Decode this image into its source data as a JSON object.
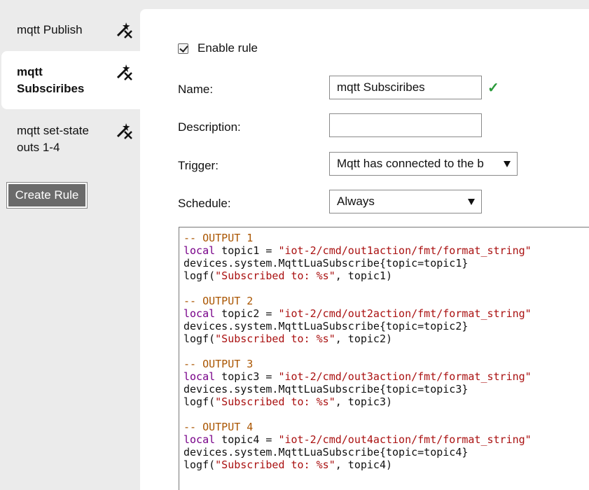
{
  "sidebar": {
    "rules": [
      {
        "label": "mqtt Publish",
        "icon": "wand-delete-icon"
      },
      {
        "label": "mqtt Subsciribes",
        "icon": "wand-delete-icon",
        "active": true
      },
      {
        "label": "mqtt set-state outs 1-4",
        "icon": "wand-delete-icon"
      }
    ],
    "create_button": "Create Rule"
  },
  "form": {
    "enable_label": "Enable rule",
    "enabled": true,
    "name_label": "Name:",
    "name_value": "mqtt Subsciribes",
    "name_valid_mark": "✓",
    "description_label": "Description:",
    "description_value": "",
    "trigger_label": "Trigger:",
    "trigger_value": "Mqtt has connected to the b",
    "schedule_label": "Schedule:",
    "schedule_value": "Always"
  },
  "code_blocks": [
    {
      "comment": "-- OUTPUT 1",
      "kw": "local",
      "var": " topic1 = ",
      "str": "\"iot-2/cmd/out1action/fmt/format_string\"",
      "call": "devices.system.MqttLuaSubscribe{topic=topic1}",
      "log_pre": "logf(",
      "log_str": "\"Subscribed to: %s\"",
      "log_post": ", topic1)"
    },
    {
      "comment": "-- OUTPUT 2",
      "kw": "local",
      "var": " topic2 = ",
      "str": "\"iot-2/cmd/out2action/fmt/format_string\"",
      "call": "devices.system.MqttLuaSubscribe{topic=topic2}",
      "log_pre": "logf(",
      "log_str": "\"Subscribed to: %s\"",
      "log_post": ", topic2)"
    },
    {
      "comment": "-- OUTPUT 3",
      "kw": "local",
      "var": " topic3 = ",
      "str": "\"iot-2/cmd/out3action/fmt/format_string\"",
      "call": "devices.system.MqttLuaSubscribe{topic=topic3}",
      "log_pre": "logf(",
      "log_str": "\"Subscribed to: %s\"",
      "log_post": ", topic3)"
    },
    {
      "comment": "-- OUTPUT 4",
      "kw": "local",
      "var": " topic4 = ",
      "str": "\"iot-2/cmd/out4action/fmt/format_string\"",
      "call": "devices.system.MqttLuaSubscribe{topic=topic4}",
      "log_pre": "logf(",
      "log_str": "\"Subscribed to: %s\"",
      "log_post": ", topic4)"
    }
  ],
  "colors": {
    "sidebar_bg": "#ebebeb",
    "button_bg": "#6b6b6b",
    "valid_green": "#2a9a3a",
    "code_comment": "#aa5500",
    "code_keyword": "#770088",
    "code_string": "#aa1111"
  }
}
